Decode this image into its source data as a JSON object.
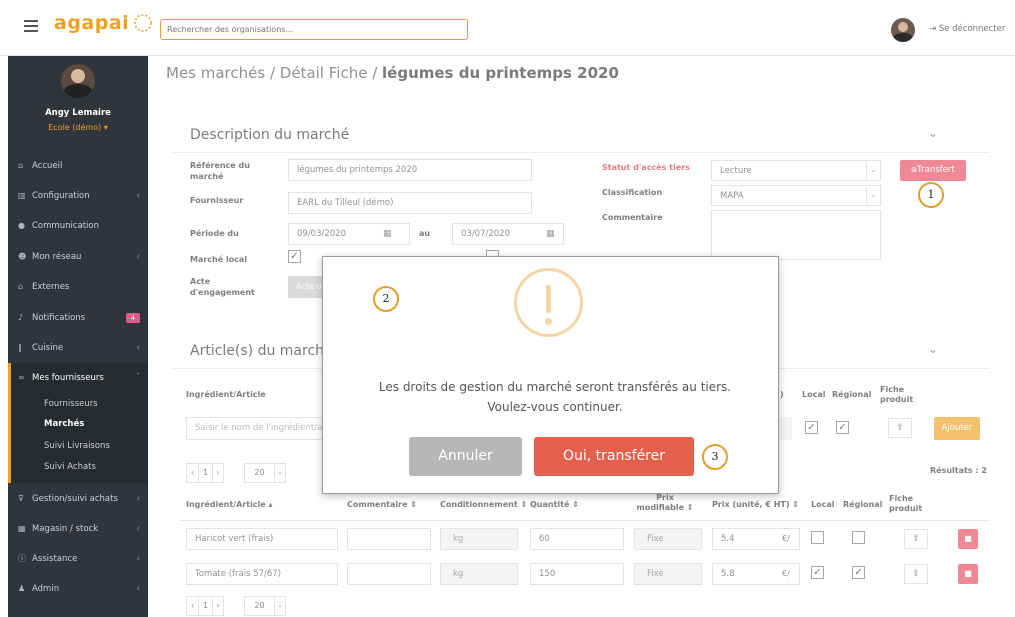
{
  "topbar": {
    "logo_text": "agapai",
    "search_placeholder": "Rechercher des organisations...",
    "logout_label": "Se déconnecter"
  },
  "user": {
    "name": "Angy Lemaire",
    "org": "Ecole (démo)"
  },
  "sidebar": {
    "items": [
      {
        "label": "Accueil",
        "icon": "home-icon"
      },
      {
        "label": "Configuration",
        "icon": "bank-icon"
      },
      {
        "label": "Communication",
        "icon": "chat-icon"
      },
      {
        "label": "Mon réseau",
        "icon": "users-icon"
      },
      {
        "label": "Externes",
        "icon": "home-icon"
      },
      {
        "label": "Notifications",
        "icon": "bell-icon",
        "badge": "4"
      },
      {
        "label": "Cuisine",
        "icon": "cutlery-icon"
      },
      {
        "label": "Mes fournisseurs",
        "icon": "handshake-icon"
      },
      {
        "label": "Gestion/suivi achats",
        "icon": "cart-icon"
      },
      {
        "label": "Magasin / stock",
        "icon": "cubes-icon"
      },
      {
        "label": "Assistance",
        "icon": "info-icon"
      },
      {
        "label": "Admin",
        "icon": "user-plus-icon"
      }
    ],
    "sub_items": [
      "Fournisseurs",
      "Marchés",
      "Suivi Livraisons",
      "Suivi Achats"
    ]
  },
  "breadcrumb": {
    "part1": "Mes marchés / Détail Fiche / ",
    "current": "légumes du printemps 2020"
  },
  "description": {
    "title": "Description du marché",
    "ref_label": "Référence du marché",
    "ref_value": "légumes du printemps 2020",
    "supplier_label": "Fournisseur",
    "supplier_value": "EARL du Tilleul (démo)",
    "period_label": "Période du",
    "date_from": "09/03/2020",
    "au_label": "au",
    "date_to": "03/07/2020",
    "local_label": "Marché local",
    "acte_label": "Acte d'engagement",
    "acte_button": "Acte d",
    "access_label": "Statut d'accès tiers",
    "access_value": "Lecture",
    "transfer_button": "Transfert",
    "class_label": "Classification",
    "class_value": "MAPA",
    "comment_label": "Commentaire"
  },
  "articles": {
    "title": "Article(s) du marché",
    "header_ingredient": "Ingrédient/Article",
    "header_local": "Local",
    "header_regional": "Régional",
    "header_fiche": "Fiche produit",
    "header_partial": ")",
    "add_placeholder": "Saisir le nom de l'ingrédient/a",
    "add_button": "Ajouter",
    "results": "Résultats : 2",
    "page": "1",
    "per_page": "20",
    "columns": {
      "ingredient": "Ingrédient/Article ▴",
      "comment": "Commentaire ⇕",
      "cond": "Conditionnement ⇕",
      "qty": "Quantité ⇕",
      "prix_mod": "Prix modifiable ⇕",
      "prix": "Prix (unité, € HT) ⇕",
      "local": "Local",
      "regional": "Régional",
      "fiche": "Fiche produit"
    },
    "rows": [
      {
        "name": "Haricot vert (frais)",
        "unit": "kg",
        "qty": "60",
        "mode": "Fixe",
        "price": "5.4",
        "cur": "€/",
        "local": false,
        "regional": false
      },
      {
        "name": "Tomate (frais 57/67)",
        "unit": "kg",
        "qty": "150",
        "mode": "Fixe",
        "price": "5.8",
        "cur": "€/",
        "local": true,
        "regional": true
      }
    ]
  },
  "modal": {
    "message": "Les droits de gestion du marché seront transférés au tiers. Voulez-vous continuer.",
    "cancel": "Annuler",
    "confirm": "Oui, transférer"
  },
  "callouts": [
    "1",
    "2",
    "3"
  ],
  "colors": {
    "brand": "#f0a020",
    "danger": "#e84a5f",
    "confirm": "#e2604c",
    "cancel": "#b7b7b7",
    "sidebar": "#2f353b",
    "warning": "#f2d6a6"
  }
}
